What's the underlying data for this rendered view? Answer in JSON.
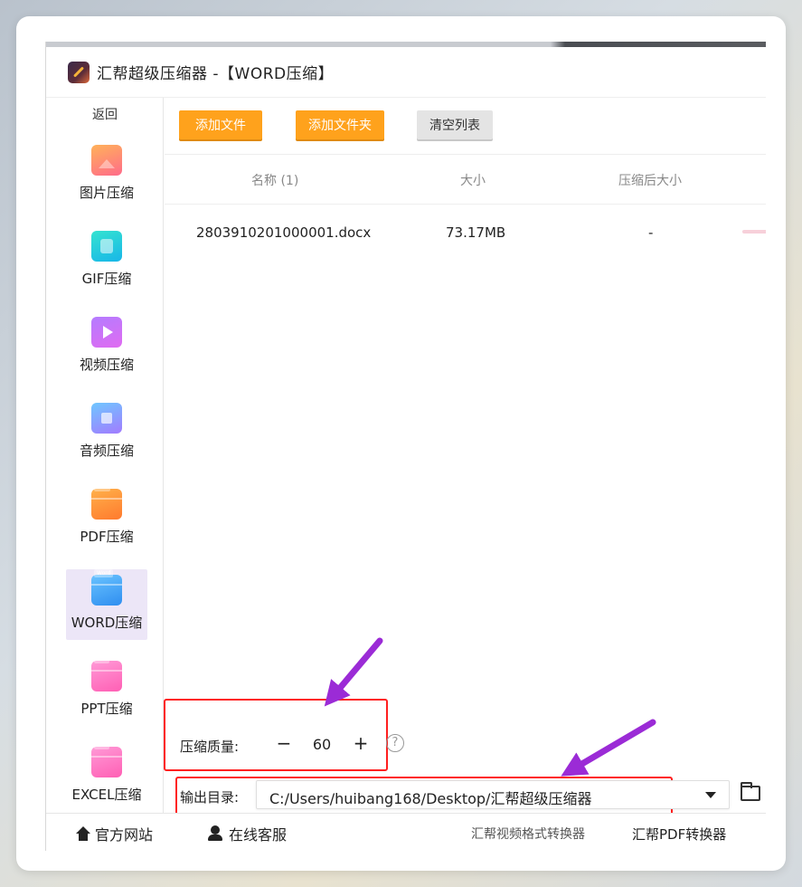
{
  "window": {
    "title": "汇帮超级压缩器  -【WORD压缩】"
  },
  "sidebar": {
    "back_label": "返回",
    "items": [
      {
        "label": "图片压缩",
        "icon": "image-compress-icon"
      },
      {
        "label": "GIF压缩",
        "icon": "gif-compress-icon"
      },
      {
        "label": "视频压缩",
        "icon": "video-compress-icon"
      },
      {
        "label": "音频压缩",
        "icon": "audio-compress-icon"
      },
      {
        "label": "PDF压缩",
        "icon": "pdf-compress-icon",
        "tag": "PDF"
      },
      {
        "label": "WORD压缩",
        "icon": "word-compress-icon",
        "tag": "Word",
        "active": true
      },
      {
        "label": "PPT压缩",
        "icon": "ppt-compress-icon",
        "tag": "PPT"
      },
      {
        "label": "EXCEL压缩",
        "icon": "excel-compress-icon",
        "tag": "PPT"
      }
    ]
  },
  "toolbar": {
    "add_file": "添加文件",
    "add_folder": "添加文件夹",
    "clear_list": "清空列表"
  },
  "table": {
    "headers": {
      "name": "名称 (1)",
      "size": "大小",
      "compressed_size": "压缩后大小"
    },
    "rows": [
      {
        "name": "2803910201000001.docx",
        "size": "73.17MB",
        "compressed_size": "-"
      }
    ]
  },
  "quality": {
    "label": "压缩质量:",
    "minus": "−",
    "value": "60",
    "plus": "+",
    "help": "?"
  },
  "output": {
    "label": "输出目录:",
    "path": "C:/Users/huibang168/Desktop/汇帮超级压缩器"
  },
  "footer": {
    "website": "官方网站",
    "support": "在线客服",
    "link1": "汇帮视频格式转换器",
    "link2": "汇帮PDF转换器"
  },
  "colors": {
    "accent_orange": "#ffa21c",
    "annotation_red": "#ff1f1f",
    "annotation_purple": "#9b2bd6",
    "active_bg": "#ece6f7"
  }
}
